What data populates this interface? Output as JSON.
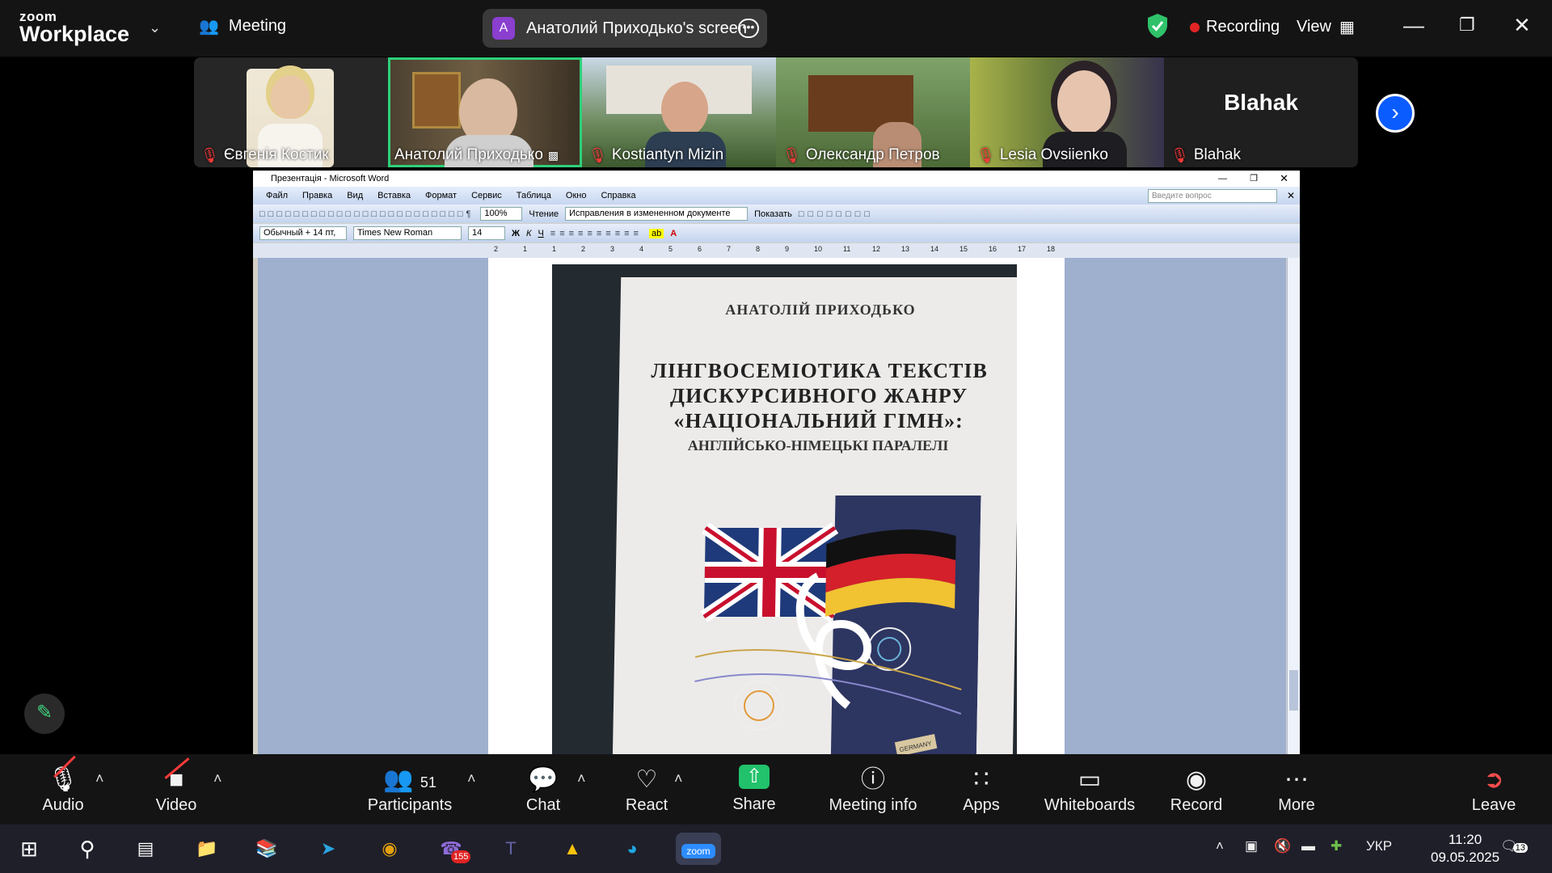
{
  "app": {
    "logo_top": "zoom",
    "logo_bottom": "Workplace",
    "meeting_label": "Meeting",
    "screen_share_label": "Анатолий Приходько's screen",
    "screen_share_initial": "A",
    "recording_label": "Recording",
    "view_label": "View"
  },
  "participants_strip": [
    {
      "name": "Євгенія Костик",
      "muted": true,
      "active": false
    },
    {
      "name": "Анатолий Приходько",
      "muted": false,
      "active": true
    },
    {
      "name": "Kostiantyn Mizin",
      "muted": true,
      "active": false
    },
    {
      "name": "Олександр Петров",
      "muted": true,
      "active": false
    },
    {
      "name": "Lesia Ovsiienko",
      "muted": true,
      "active": false
    },
    {
      "name": "Blahak",
      "muted": true,
      "active": false,
      "label_large": "Blahak"
    }
  ],
  "word": {
    "window_title": "Презентація - Microsoft Word",
    "menu": [
      "Файл",
      "Правка",
      "Вид",
      "Вставка",
      "Формат",
      "Сервис",
      "Таблица",
      "Окно",
      "Справка"
    ],
    "ask_placeholder": "Введите вопрос",
    "zoom": "100%",
    "reading_btn": "Чтение",
    "track_changes": "Исправления в измененном документе",
    "show_btn": "Показать",
    "style": "Обычный + 14 пт,",
    "font": "Times New Roman",
    "size": "14",
    "ruler_marks": [
      "2",
      "1",
      "1",
      "2",
      "3",
      "4",
      "5",
      "6",
      "7",
      "8",
      "9",
      "10",
      "11",
      "12",
      "13",
      "14",
      "15",
      "16",
      "17",
      "18"
    ]
  },
  "book": {
    "author": "АНАТОЛІЙ ПРИХОДЬКО",
    "title_lines": [
      "ЛІНГВОСЕМІОТИКА ТЕКСТІВ",
      "ДИСКУРСИВНОГО ЖАНРУ",
      "«НАЦІОНАЛЬНИЙ ГІМН»:"
    ],
    "subtitle": "АНГЛІЙСЬКО-НІМЕЦЬКІ ПАРАЛЕЛІ",
    "badge": "GERMANY"
  },
  "controls": {
    "audio": "Audio",
    "video": "Video",
    "participants": "Participants",
    "participants_count": "51",
    "chat": "Chat",
    "react": "React",
    "share": "Share",
    "meeting_info": "Meeting info",
    "apps": "Apps",
    "whiteboards": "Whiteboards",
    "record": "Record",
    "more": "More",
    "leave": "Leave"
  },
  "taskbar": {
    "language": "УКР",
    "time": "11:20",
    "date": "09.05.2025",
    "viber_badge": "155",
    "notifications": "13"
  }
}
